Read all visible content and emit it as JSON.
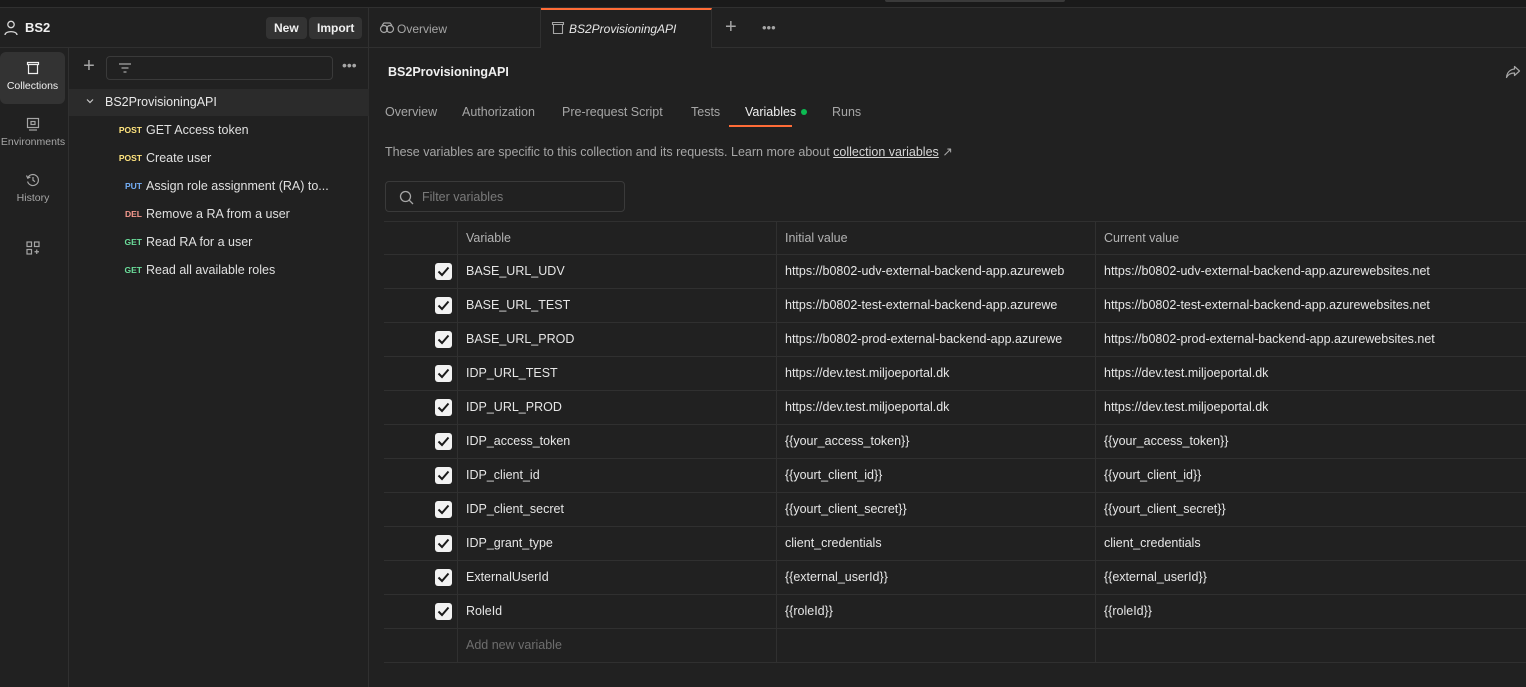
{
  "workspace": {
    "name": "BS2",
    "new_label": "New",
    "import_label": "Import"
  },
  "rail": {
    "items": [
      {
        "label": "Collections",
        "icon": "collections-icon",
        "active": true
      },
      {
        "label": "Environments",
        "icon": "environments-icon",
        "active": false
      },
      {
        "label": "History",
        "icon": "history-icon",
        "active": false
      },
      {
        "label": "",
        "icon": "apps-add-icon",
        "active": false
      }
    ]
  },
  "sidebar": {
    "collection_name": "BS2ProvisioningAPI",
    "requests": [
      {
        "method": "POST",
        "name": "GET Access token"
      },
      {
        "method": "POST",
        "name": "Create user"
      },
      {
        "method": "PUT",
        "name": "Assign role assignment (RA) to..."
      },
      {
        "method": "DEL",
        "name": "Remove a RA from a user"
      },
      {
        "method": "GET",
        "name": "Read RA for a user"
      },
      {
        "method": "GET",
        "name": "Read all available roles"
      }
    ]
  },
  "tabs": {
    "items": [
      {
        "label": "Overview"
      },
      {
        "label": "BS2ProvisioningAPI"
      }
    ]
  },
  "main": {
    "title": "BS2ProvisioningAPI",
    "subtabs": [
      "Overview",
      "Authorization",
      "Pre-request Script",
      "Tests",
      "Variables",
      "Runs"
    ],
    "description_prefix": "These variables are specific to this collection and its requests. Learn more about ",
    "description_link": "collection variables",
    "description_arrow": "↗",
    "filter_placeholder": "Filter variables"
  },
  "table": {
    "headers": {
      "variable": "Variable",
      "initial": "Initial value",
      "current": "Current value"
    },
    "rows": [
      {
        "variable": "BASE_URL_UDV",
        "initial": "https://b0802-udv-external-backend-app.azureweb",
        "current": "https://b0802-udv-external-backend-app.azurewebsites.net",
        "checked": true
      },
      {
        "variable": "BASE_URL_TEST",
        "initial": "https://b0802-test-external-backend-app.azurewe",
        "current": "https://b0802-test-external-backend-app.azurewebsites.net",
        "checked": true
      },
      {
        "variable": "BASE_URL_PROD",
        "initial": "https://b0802-prod-external-backend-app.azurewe",
        "current": "https://b0802-prod-external-backend-app.azurewebsites.net",
        "checked": true
      },
      {
        "variable": "IDP_URL_TEST",
        "initial": "https://dev.test.miljoeportal.dk",
        "current": "https://dev.test.miljoeportal.dk",
        "checked": true
      },
      {
        "variable": "IDP_URL_PROD",
        "initial": "https://dev.test.miljoeportal.dk",
        "current": "https://dev.test.miljoeportal.dk",
        "checked": true
      },
      {
        "variable": "IDP_access_token",
        "initial": "{{your_access_token}}",
        "current": "{{your_access_token}}",
        "checked": true
      },
      {
        "variable": "IDP_client_id",
        "initial": "{{yourt_client_id}}",
        "current": "{{yourt_client_id}}",
        "checked": true
      },
      {
        "variable": "IDP_client_secret",
        "initial": "{{yourt_client_secret}}",
        "current": "{{yourt_client_secret}}",
        "checked": true
      },
      {
        "variable": "IDP_grant_type",
        "initial": "client_credentials",
        "current": "client_credentials",
        "checked": true
      },
      {
        "variable": "ExternalUserId",
        "initial": "{{external_userId}}",
        "current": "{{external_userId}}",
        "checked": true
      },
      {
        "variable": "RoleId",
        "initial": "{{roleId}}",
        "current": "{{roleId}}",
        "checked": true
      }
    ],
    "add_placeholder": "Add new variable"
  },
  "colors": {
    "accent": "#ff6c37",
    "post": "#ffe47e",
    "put": "#74aef6",
    "del": "#f79a8e",
    "get": "#6bdd9a",
    "status_dot": "#0cbb52"
  }
}
